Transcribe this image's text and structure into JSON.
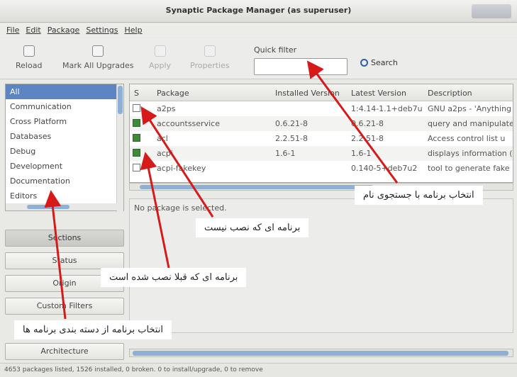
{
  "window": {
    "title": "Synaptic Package Manager  (as superuser)"
  },
  "menu": [
    "File",
    "Edit",
    "Package",
    "Settings",
    "Help"
  ],
  "toolbar": {
    "reload": "Reload",
    "mark_all": "Mark All Upgrades",
    "apply": "Apply",
    "properties": "Properties",
    "quick_filter_label": "Quick filter",
    "search": "Search"
  },
  "sections": [
    "All",
    "Communication",
    "Cross Platform",
    "Databases",
    "Debug",
    "Development",
    "Documentation",
    "Editors"
  ],
  "filter_buttons": {
    "sections": "Sections",
    "status": "Status",
    "origin": "Origin",
    "custom_filters": "Custom Filters",
    "architecture": "Architecture"
  },
  "table": {
    "headers": {
      "s": "S",
      "package": "Package",
      "installed": "Installed Version",
      "latest": "Latest Version",
      "description": "Description"
    },
    "rows": [
      {
        "name": "a2ps",
        "installed": "",
        "latest": "1:4.14-1.1+deb7u",
        "description": "GNU a2ps - 'Anything",
        "status": "not-installed"
      },
      {
        "name": "accountsservice",
        "installed": "0.6.21-8",
        "latest": "0.6.21-8",
        "description": "query and manipulate",
        "status": "installed"
      },
      {
        "name": "acl",
        "installed": "2.2.51-8",
        "latest": "2.2.51-8",
        "description": "Access control list u",
        "status": "installed"
      },
      {
        "name": "acpi",
        "installed": "1.6-1",
        "latest": "1.6-1",
        "description": "displays information (",
        "status": "installed"
      },
      {
        "name": "acpi-fakekey",
        "installed": "",
        "latest": "0.140-5+deb7u2",
        "description": "tool to generate fake",
        "status": "not-installed"
      }
    ]
  },
  "detail": {
    "text": "No package is selected."
  },
  "statusbar": "4653 packages listed, 1526 installed, 0 broken. 0 to install/upgrade, 0 to remove",
  "annotations": {
    "search": "انتخاب برنامه با جستجوی نام",
    "not_installed": "برنامه ای که نصب نیست",
    "installed": "برنامه ای که قبلا نصب شده است",
    "categories": "انتخاب برنامه از دسته بندی برنامه ها"
  },
  "colors": {
    "selection": "#5b86c2",
    "installed_box": "#3e8a3a",
    "arrow": "#d61a1a"
  }
}
